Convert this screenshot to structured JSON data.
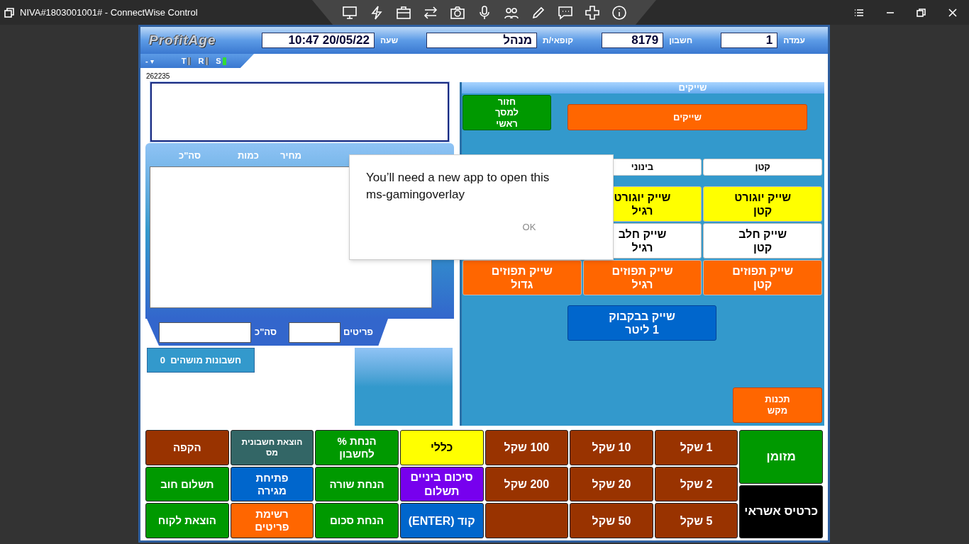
{
  "window": {
    "title": "NIVA#1803001001# - ConnectWise Control"
  },
  "header": {
    "logo": "ProfitAge",
    "fields": [
      {
        "label": "עמדה",
        "value": "1"
      },
      {
        "label": "חשבון",
        "value": "8179"
      },
      {
        "label": "קופאי/ת",
        "value": "מנהל"
      },
      {
        "label": "שעה",
        "value": "10:47 20/05/22"
      }
    ],
    "status_tab": {
      "minus": "-",
      "caret": "▾",
      "indicators": [
        {
          "label": "S",
          "on": true
        },
        {
          "label": "R",
          "on": false
        },
        {
          "label": "T",
          "on": false
        }
      ]
    }
  },
  "left": {
    "code": "262235",
    "items_table": {
      "columns": [
        "מחיר",
        "כמות",
        "סה\"כ"
      ]
    },
    "footer": {
      "items_label": "פריטים",
      "total_label": "סה\"כ"
    },
    "held_button": {
      "count": "0",
      "label": "חשבונות מושהים"
    }
  },
  "category_panel": {
    "title": "שייקים",
    "back_button": "חזור\nלמסך\nראשי",
    "category_button": "שייקים",
    "size_headers": [
      "קטן",
      "בינוני"
    ],
    "products": [
      [
        {
          "label": "שייק  יוגורט\nקטן",
          "color": "#ffff00"
        },
        {
          "label": "שייק יוגורט\nרגיל",
          "color": "#ffff00"
        }
      ],
      [
        {
          "label": "שייק חלב\nקטן",
          "color": "#ffffff"
        },
        {
          "label": "שייק חלב\nרגיל",
          "color": "#ffffff"
        }
      ],
      [
        {
          "label": "שייק תפוזים\nקטן",
          "color": "#ff6600"
        },
        {
          "label": "שייק תפוזים\nרגיל",
          "color": "#ff6600"
        },
        {
          "label": "שייק תפוזים\nגדול",
          "color": "#ff6600"
        }
      ]
    ],
    "bottle_button": "שייק בבקבוק\n1 ליטר",
    "program_button": "תכנות\nמקש"
  },
  "keypad": {
    "columns": [
      [
        {
          "label": "מזומן",
          "color": "#009900"
        },
        {
          "label": "כרטיס אשראי",
          "color": "#000000"
        }
      ],
      [
        {
          "label": "1 שקל",
          "color": "#993300"
        },
        {
          "label": "2 שקל",
          "color": "#993300"
        },
        {
          "label": "5 שקל",
          "color": "#993300"
        }
      ],
      [
        {
          "label": "10 שקל",
          "color": "#993300"
        },
        {
          "label": "20 שקל",
          "color": "#993300"
        },
        {
          "label": "50 שקל",
          "color": "#993300"
        }
      ],
      [
        {
          "label": "100 שקל",
          "color": "#993300"
        },
        {
          "label": "200 שקל",
          "color": "#993300"
        },
        {
          "color": "#993300"
        }
      ],
      [
        {
          "label": "כללי",
          "color": "#ffff00"
        },
        {
          "label": "סיכום ביניים\nתשלום",
          "color": "#7700ee"
        },
        {
          "label": "קוד (ENTER)",
          "color": "#0066cc"
        }
      ],
      [
        {
          "label": "הנחת %\nלחשבון",
          "color": "#009900"
        },
        {
          "label": "הנחת  שורה",
          "color": "#009900"
        },
        {
          "label": "הנחת סכום",
          "color": "#009900"
        }
      ],
      [
        {
          "label": "הוצאת חשבונית\nמס",
          "color": "#336666"
        },
        {
          "label": "פתיחת\nמגירה",
          "color": "#0066cc"
        },
        {
          "label": "רשימת\nפריטים",
          "color": "#ff6600"
        }
      ],
      [
        {
          "label": "הקפה",
          "color": "#993300"
        },
        {
          "label": "תשלום חוב",
          "color": "#009900"
        },
        {
          "label": "הוצאת לקוח",
          "color": "#009900"
        }
      ]
    ]
  },
  "dialog": {
    "message": "You’ll need a new app to open this ms-gamingoverlay",
    "button": "OK"
  }
}
